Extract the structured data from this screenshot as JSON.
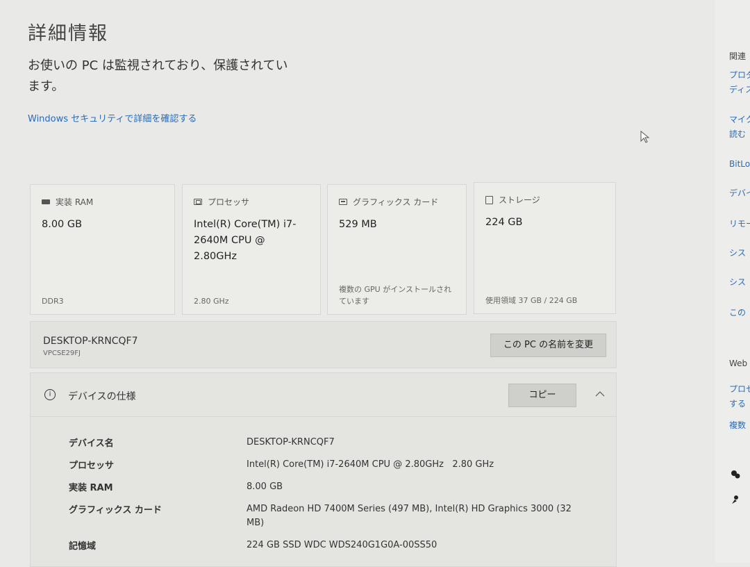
{
  "page": {
    "title": "詳細情報",
    "status": "お使いの PC は監視されており、保護されています。",
    "security_link": "Windows セキュリティで詳細を確認する"
  },
  "cards": [
    {
      "name": "ram",
      "icon": "ram-icon",
      "label": "実装 RAM",
      "value": "8.00 GB",
      "footer": "DDR3"
    },
    {
      "name": "processor",
      "icon": "processor-icon",
      "label": "プロセッサ",
      "value": "Intel(R) Core(TM) i7-2640M CPU @ 2.80GHz",
      "footer": "2.80 GHz"
    },
    {
      "name": "graphics",
      "icon": "graphics-card-icon",
      "label": "グラフィックス カード",
      "value": "529 MB",
      "footer": "複数の GPU がインストールされています"
    },
    {
      "name": "storage",
      "icon": "storage-icon",
      "label": "ストレージ",
      "value": "224 GB",
      "footer": "使用領域 37 GB / 224 GB"
    }
  ],
  "device": {
    "name": "DESKTOP-KRNCQF7",
    "model": "VPCSE29FJ",
    "rename_button": "この PC の名前を変更"
  },
  "spec": {
    "title": "デバイスの仕様",
    "copy_button": "コピー",
    "rows": [
      {
        "key": "デバイス名",
        "value": "DESKTOP-KRNCQF7"
      },
      {
        "key": "プロセッサ",
        "value": "Intel(R) Core(TM) i7-2640M CPU @ 2.80GHz   2.80 GHz"
      },
      {
        "key": "実装 RAM",
        "value": "8.00 GB"
      },
      {
        "key": "グラフィックス カード",
        "value": "AMD Radeon HD 7400M Series (497 MB), Intel(R) HD Graphics 3000 (32 MB)"
      },
      {
        "key": "記憶域",
        "value": "224 GB SSD WDC WDS240G1G0A-00SS50"
      }
    ]
  },
  "right_pane": {
    "heading": "関連",
    "items": [
      "プロダ",
      "ディス",
      "マイク",
      "読む",
      "BitLo",
      "デバイ",
      "リモー",
      "シス",
      "シス",
      "この"
    ],
    "web_heading": "Web",
    "web_items": [
      "プロセ",
      "する",
      "複数"
    ]
  },
  "colors": {
    "link": "#2a6bb5",
    "background": "#e9e9e7"
  }
}
